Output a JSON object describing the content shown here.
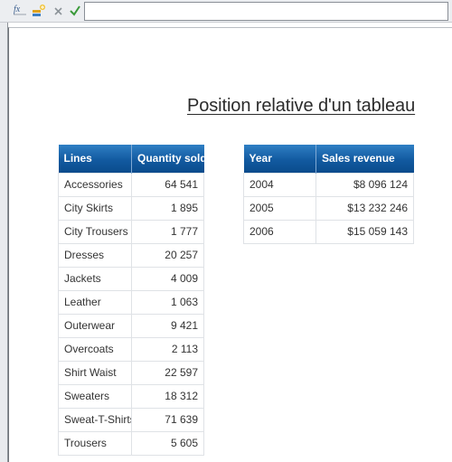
{
  "toolbar": {
    "icons": [
      "formula-fx-icon",
      "variable-icon",
      "cancel-x-icon",
      "validate-check-icon"
    ],
    "formula_value": "",
    "check_color": "#3a9a3a",
    "x_color": "#8c9399"
  },
  "report": {
    "title": "Position relative d'un tableau",
    "header_color": "#125aa0"
  },
  "lines_table": {
    "headers": [
      "Lines",
      "Quantity sold"
    ],
    "rows": [
      [
        "Accessories",
        "64 541"
      ],
      [
        "City Skirts",
        "1 895"
      ],
      [
        "City Trousers",
        "1 777"
      ],
      [
        "Dresses",
        "20 257"
      ],
      [
        "Jackets",
        "4 009"
      ],
      [
        "Leather",
        "1 063"
      ],
      [
        "Outerwear",
        "9 421"
      ],
      [
        "Overcoats",
        "2 113"
      ],
      [
        "Shirt Waist",
        "22 597"
      ],
      [
        "Sweaters",
        "18 312"
      ],
      [
        "Sweat-T-Shirts",
        "71 639"
      ],
      [
        "Trousers",
        "5 605"
      ]
    ]
  },
  "year_table": {
    "headers": [
      "Year",
      "Sales revenue"
    ],
    "rows": [
      [
        "2004",
        "$8 096 124"
      ],
      [
        "2005",
        "$13 232 246"
      ],
      [
        "2006",
        "$15 059 143"
      ]
    ]
  }
}
